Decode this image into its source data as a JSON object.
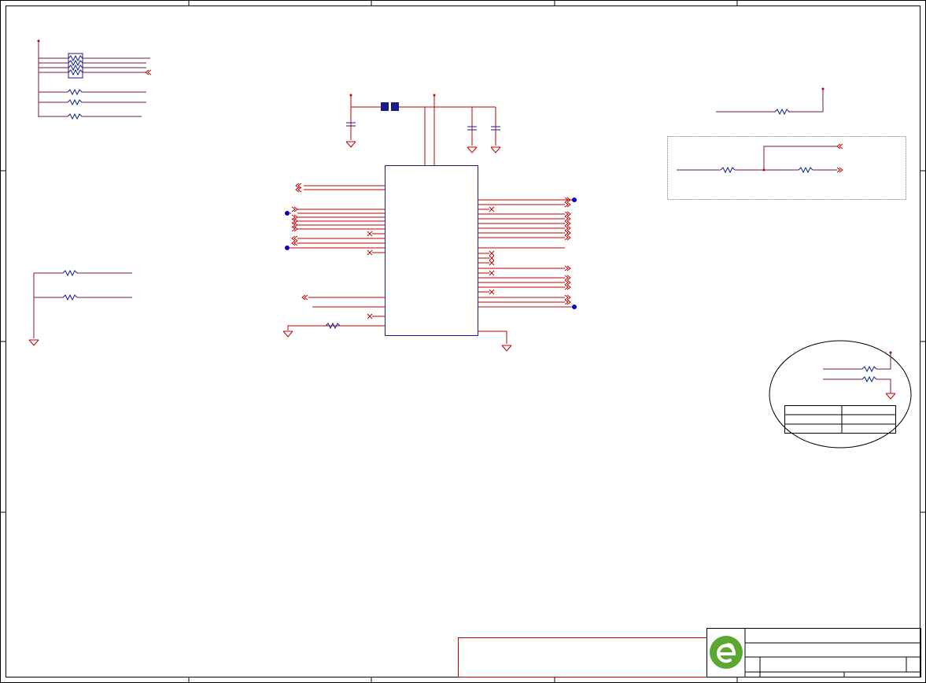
{
  "sheet": {
    "background": "#ffffff",
    "wire_color": "#c00000",
    "part_color": "#1a1a8c",
    "junction_color": "#0000cc",
    "logo_color": "#5aa832"
  },
  "components": {
    "resistor_icon": "resistor-icon",
    "capacitor_icon": "capacitor-icon",
    "ground_icon": "ground-icon",
    "ic_body": "ic-body",
    "ferrite_bead": "ferrite-bead-icon"
  },
  "title_block": {
    "logo": "company-logo"
  }
}
